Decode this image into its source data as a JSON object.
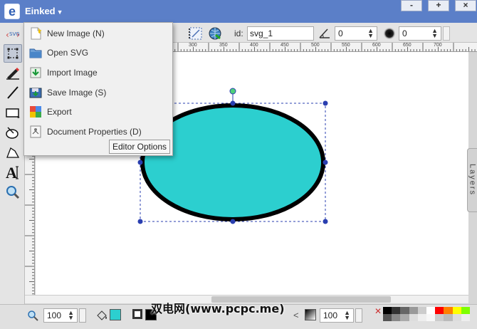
{
  "app": {
    "name": "Einked"
  },
  "window": {
    "minimize": "-",
    "maximize": "+",
    "close": "×"
  },
  "toolbar": {
    "id_label": "id:",
    "id_value": "svg_1",
    "stroke_width": "0",
    "opacity": "0"
  },
  "ruler": {
    "top_labels": [
      "300",
      "350",
      "400",
      "450",
      "500",
      "550",
      "600",
      "650",
      "700"
    ],
    "left_labels": [
      "150",
      "200",
      "250",
      "300",
      "350"
    ]
  },
  "menu": {
    "items": [
      {
        "label": "New Image (N)",
        "icon": "new-image-icon"
      },
      {
        "label": "Open SVG",
        "icon": "folder-icon"
      },
      {
        "label": "Import Image",
        "icon": "import-icon"
      },
      {
        "label": "Save Image (S)",
        "icon": "save-icon"
      },
      {
        "label": "Export",
        "icon": "export-icon"
      },
      {
        "label": "Document Properties (D)",
        "icon": "document-properties-icon"
      }
    ],
    "editor_options": "Editor Options"
  },
  "side_panel": {
    "layers": "Layers"
  },
  "bottom": {
    "zoom": "100",
    "opacity": "100"
  },
  "watermark": "双电网(www.pcpc.me)",
  "colors": {
    "ellipse_fill": "#2ccfcf",
    "ellipse_stroke": "#000000",
    "selection": "#2a3fb0",
    "title_bar": "#5b7fc8"
  }
}
